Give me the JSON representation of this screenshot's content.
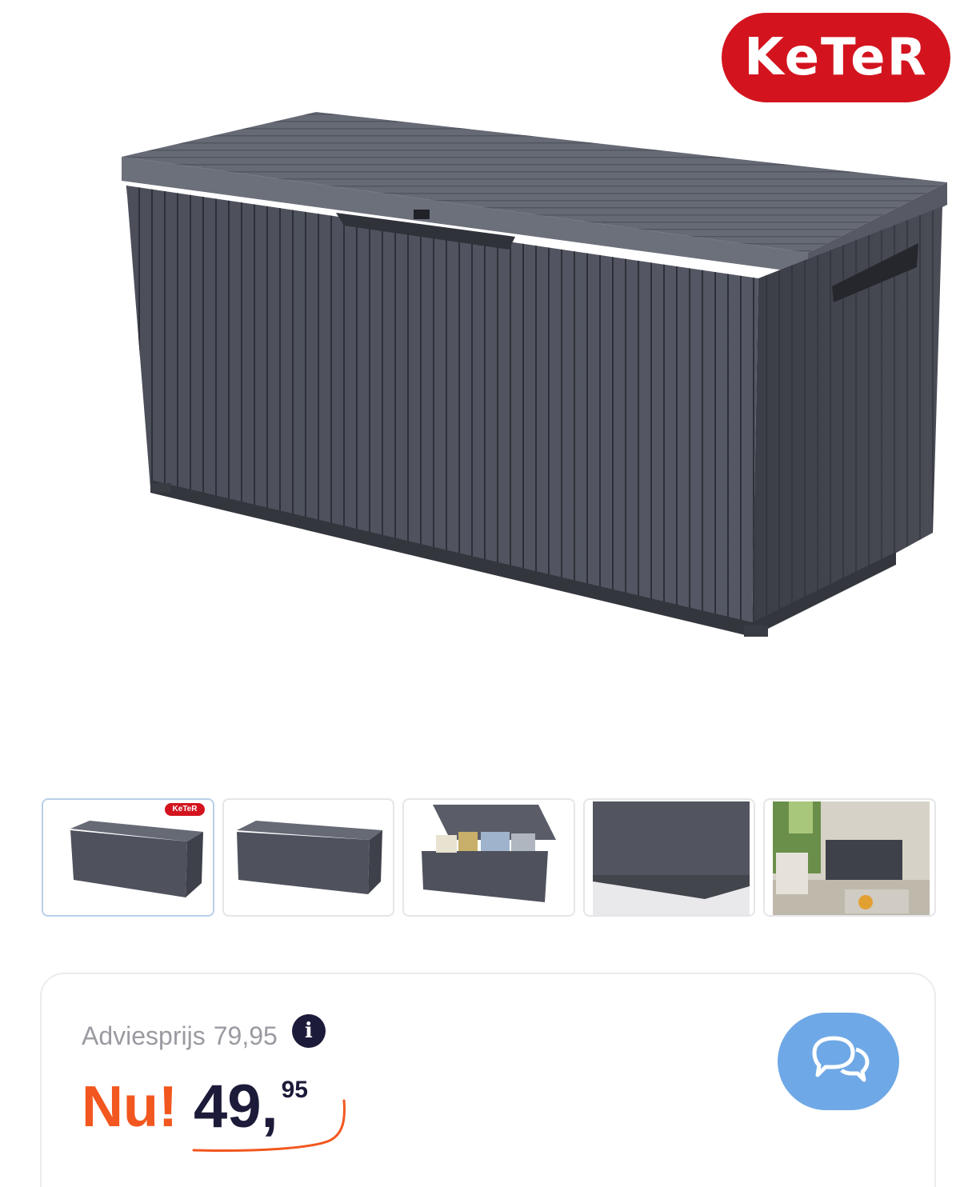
{
  "brand": {
    "logo_text": "KeTeR",
    "accent_color": "#d3141f"
  },
  "main_image": {
    "alt": "product-photo",
    "icon": "storage-box-image"
  },
  "thumbnails": [
    {
      "name": "thumb-front-logo",
      "active": true,
      "badge": "KeTeR"
    },
    {
      "name": "thumb-front",
      "active": false
    },
    {
      "name": "thumb-open-lid",
      "active": false
    },
    {
      "name": "thumb-closeup",
      "active": false
    },
    {
      "name": "thumb-garden",
      "active": false
    }
  ],
  "price": {
    "advice_label": "Adviesprijs",
    "advice_value": "79,95",
    "info_icon": "i",
    "now_label": "Nu!",
    "now_main": "49,",
    "now_cents": "95",
    "accent_color": "#f2571f",
    "price_color": "#1d1b3a"
  },
  "chat": {
    "icon": "chat-bubbles-icon",
    "color": "#6fa8e6"
  }
}
